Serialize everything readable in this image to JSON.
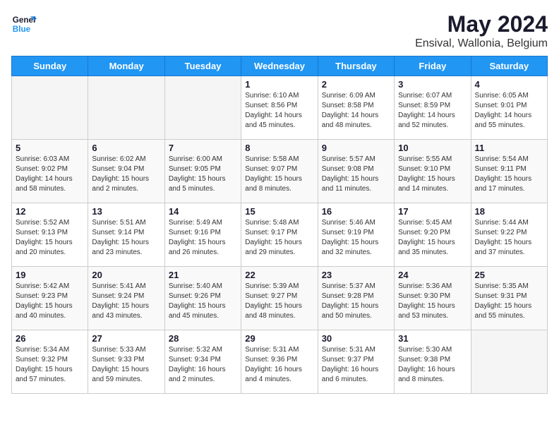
{
  "header": {
    "logo_general": "General",
    "logo_blue": "Blue",
    "month": "May 2024",
    "location": "Ensival, Wallonia, Belgium"
  },
  "weekdays": [
    "Sunday",
    "Monday",
    "Tuesday",
    "Wednesday",
    "Thursday",
    "Friday",
    "Saturday"
  ],
  "weeks": [
    [
      {
        "day": "",
        "sunrise": "",
        "sunset": "",
        "daylight": ""
      },
      {
        "day": "",
        "sunrise": "",
        "sunset": "",
        "daylight": ""
      },
      {
        "day": "",
        "sunrise": "",
        "sunset": "",
        "daylight": ""
      },
      {
        "day": "1",
        "sunrise": "Sunrise: 6:10 AM",
        "sunset": "Sunset: 8:56 PM",
        "daylight": "Daylight: 14 hours and 45 minutes."
      },
      {
        "day": "2",
        "sunrise": "Sunrise: 6:09 AM",
        "sunset": "Sunset: 8:58 PM",
        "daylight": "Daylight: 14 hours and 48 minutes."
      },
      {
        "day": "3",
        "sunrise": "Sunrise: 6:07 AM",
        "sunset": "Sunset: 8:59 PM",
        "daylight": "Daylight: 14 hours and 52 minutes."
      },
      {
        "day": "4",
        "sunrise": "Sunrise: 6:05 AM",
        "sunset": "Sunset: 9:01 PM",
        "daylight": "Daylight: 14 hours and 55 minutes."
      }
    ],
    [
      {
        "day": "5",
        "sunrise": "Sunrise: 6:03 AM",
        "sunset": "Sunset: 9:02 PM",
        "daylight": "Daylight: 14 hours and 58 minutes."
      },
      {
        "day": "6",
        "sunrise": "Sunrise: 6:02 AM",
        "sunset": "Sunset: 9:04 PM",
        "daylight": "Daylight: 15 hours and 2 minutes."
      },
      {
        "day": "7",
        "sunrise": "Sunrise: 6:00 AM",
        "sunset": "Sunset: 9:05 PM",
        "daylight": "Daylight: 15 hours and 5 minutes."
      },
      {
        "day": "8",
        "sunrise": "Sunrise: 5:58 AM",
        "sunset": "Sunset: 9:07 PM",
        "daylight": "Daylight: 15 hours and 8 minutes."
      },
      {
        "day": "9",
        "sunrise": "Sunrise: 5:57 AM",
        "sunset": "Sunset: 9:08 PM",
        "daylight": "Daylight: 15 hours and 11 minutes."
      },
      {
        "day": "10",
        "sunrise": "Sunrise: 5:55 AM",
        "sunset": "Sunset: 9:10 PM",
        "daylight": "Daylight: 15 hours and 14 minutes."
      },
      {
        "day": "11",
        "sunrise": "Sunrise: 5:54 AM",
        "sunset": "Sunset: 9:11 PM",
        "daylight": "Daylight: 15 hours and 17 minutes."
      }
    ],
    [
      {
        "day": "12",
        "sunrise": "Sunrise: 5:52 AM",
        "sunset": "Sunset: 9:13 PM",
        "daylight": "Daylight: 15 hours and 20 minutes."
      },
      {
        "day": "13",
        "sunrise": "Sunrise: 5:51 AM",
        "sunset": "Sunset: 9:14 PM",
        "daylight": "Daylight: 15 hours and 23 minutes."
      },
      {
        "day": "14",
        "sunrise": "Sunrise: 5:49 AM",
        "sunset": "Sunset: 9:16 PM",
        "daylight": "Daylight: 15 hours and 26 minutes."
      },
      {
        "day": "15",
        "sunrise": "Sunrise: 5:48 AM",
        "sunset": "Sunset: 9:17 PM",
        "daylight": "Daylight: 15 hours and 29 minutes."
      },
      {
        "day": "16",
        "sunrise": "Sunrise: 5:46 AM",
        "sunset": "Sunset: 9:19 PM",
        "daylight": "Daylight: 15 hours and 32 minutes."
      },
      {
        "day": "17",
        "sunrise": "Sunrise: 5:45 AM",
        "sunset": "Sunset: 9:20 PM",
        "daylight": "Daylight: 15 hours and 35 minutes."
      },
      {
        "day": "18",
        "sunrise": "Sunrise: 5:44 AM",
        "sunset": "Sunset: 9:22 PM",
        "daylight": "Daylight: 15 hours and 37 minutes."
      }
    ],
    [
      {
        "day": "19",
        "sunrise": "Sunrise: 5:42 AM",
        "sunset": "Sunset: 9:23 PM",
        "daylight": "Daylight: 15 hours and 40 minutes."
      },
      {
        "day": "20",
        "sunrise": "Sunrise: 5:41 AM",
        "sunset": "Sunset: 9:24 PM",
        "daylight": "Daylight: 15 hours and 43 minutes."
      },
      {
        "day": "21",
        "sunrise": "Sunrise: 5:40 AM",
        "sunset": "Sunset: 9:26 PM",
        "daylight": "Daylight: 15 hours and 45 minutes."
      },
      {
        "day": "22",
        "sunrise": "Sunrise: 5:39 AM",
        "sunset": "Sunset: 9:27 PM",
        "daylight": "Daylight: 15 hours and 48 minutes."
      },
      {
        "day": "23",
        "sunrise": "Sunrise: 5:37 AM",
        "sunset": "Sunset: 9:28 PM",
        "daylight": "Daylight: 15 hours and 50 minutes."
      },
      {
        "day": "24",
        "sunrise": "Sunrise: 5:36 AM",
        "sunset": "Sunset: 9:30 PM",
        "daylight": "Daylight: 15 hours and 53 minutes."
      },
      {
        "day": "25",
        "sunrise": "Sunrise: 5:35 AM",
        "sunset": "Sunset: 9:31 PM",
        "daylight": "Daylight: 15 hours and 55 minutes."
      }
    ],
    [
      {
        "day": "26",
        "sunrise": "Sunrise: 5:34 AM",
        "sunset": "Sunset: 9:32 PM",
        "daylight": "Daylight: 15 hours and 57 minutes."
      },
      {
        "day": "27",
        "sunrise": "Sunrise: 5:33 AM",
        "sunset": "Sunset: 9:33 PM",
        "daylight": "Daylight: 15 hours and 59 minutes."
      },
      {
        "day": "28",
        "sunrise": "Sunrise: 5:32 AM",
        "sunset": "Sunset: 9:34 PM",
        "daylight": "Daylight: 16 hours and 2 minutes."
      },
      {
        "day": "29",
        "sunrise": "Sunrise: 5:31 AM",
        "sunset": "Sunset: 9:36 PM",
        "daylight": "Daylight: 16 hours and 4 minutes."
      },
      {
        "day": "30",
        "sunrise": "Sunrise: 5:31 AM",
        "sunset": "Sunset: 9:37 PM",
        "daylight": "Daylight: 16 hours and 6 minutes."
      },
      {
        "day": "31",
        "sunrise": "Sunrise: 5:30 AM",
        "sunset": "Sunset: 9:38 PM",
        "daylight": "Daylight: 16 hours and 8 minutes."
      },
      {
        "day": "",
        "sunrise": "",
        "sunset": "",
        "daylight": ""
      }
    ]
  ]
}
